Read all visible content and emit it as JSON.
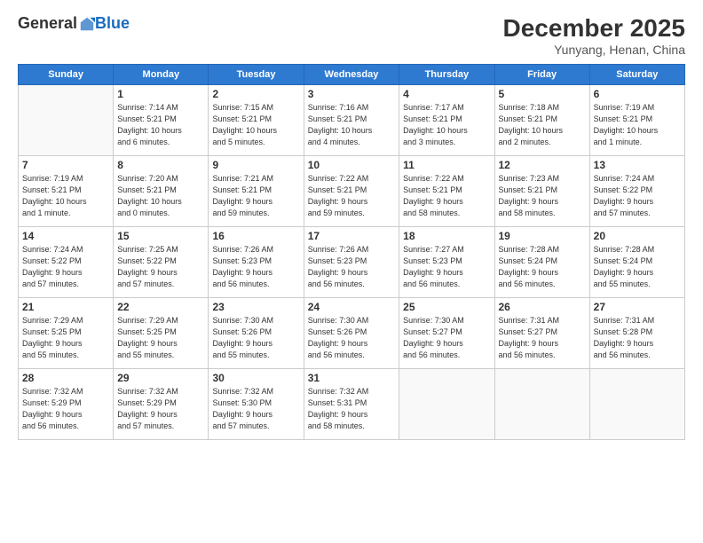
{
  "header": {
    "logo_general": "General",
    "logo_blue": "Blue",
    "month_title": "December 2025",
    "location": "Yunyang, Henan, China"
  },
  "days_of_week": [
    "Sunday",
    "Monday",
    "Tuesday",
    "Wednesday",
    "Thursday",
    "Friday",
    "Saturday"
  ],
  "weeks": [
    [
      {
        "day": "",
        "info": ""
      },
      {
        "day": "1",
        "info": "Sunrise: 7:14 AM\nSunset: 5:21 PM\nDaylight: 10 hours\nand 6 minutes."
      },
      {
        "day": "2",
        "info": "Sunrise: 7:15 AM\nSunset: 5:21 PM\nDaylight: 10 hours\nand 5 minutes."
      },
      {
        "day": "3",
        "info": "Sunrise: 7:16 AM\nSunset: 5:21 PM\nDaylight: 10 hours\nand 4 minutes."
      },
      {
        "day": "4",
        "info": "Sunrise: 7:17 AM\nSunset: 5:21 PM\nDaylight: 10 hours\nand 3 minutes."
      },
      {
        "day": "5",
        "info": "Sunrise: 7:18 AM\nSunset: 5:21 PM\nDaylight: 10 hours\nand 2 minutes."
      },
      {
        "day": "6",
        "info": "Sunrise: 7:19 AM\nSunset: 5:21 PM\nDaylight: 10 hours\nand 1 minute."
      }
    ],
    [
      {
        "day": "7",
        "info": "Sunrise: 7:19 AM\nSunset: 5:21 PM\nDaylight: 10 hours\nand 1 minute."
      },
      {
        "day": "8",
        "info": "Sunrise: 7:20 AM\nSunset: 5:21 PM\nDaylight: 10 hours\nand 0 minutes."
      },
      {
        "day": "9",
        "info": "Sunrise: 7:21 AM\nSunset: 5:21 PM\nDaylight: 9 hours\nand 59 minutes."
      },
      {
        "day": "10",
        "info": "Sunrise: 7:22 AM\nSunset: 5:21 PM\nDaylight: 9 hours\nand 59 minutes."
      },
      {
        "day": "11",
        "info": "Sunrise: 7:22 AM\nSunset: 5:21 PM\nDaylight: 9 hours\nand 58 minutes."
      },
      {
        "day": "12",
        "info": "Sunrise: 7:23 AM\nSunset: 5:21 PM\nDaylight: 9 hours\nand 58 minutes."
      },
      {
        "day": "13",
        "info": "Sunrise: 7:24 AM\nSunset: 5:22 PM\nDaylight: 9 hours\nand 57 minutes."
      }
    ],
    [
      {
        "day": "14",
        "info": "Sunrise: 7:24 AM\nSunset: 5:22 PM\nDaylight: 9 hours\nand 57 minutes."
      },
      {
        "day": "15",
        "info": "Sunrise: 7:25 AM\nSunset: 5:22 PM\nDaylight: 9 hours\nand 57 minutes."
      },
      {
        "day": "16",
        "info": "Sunrise: 7:26 AM\nSunset: 5:23 PM\nDaylight: 9 hours\nand 56 minutes."
      },
      {
        "day": "17",
        "info": "Sunrise: 7:26 AM\nSunset: 5:23 PM\nDaylight: 9 hours\nand 56 minutes."
      },
      {
        "day": "18",
        "info": "Sunrise: 7:27 AM\nSunset: 5:23 PM\nDaylight: 9 hours\nand 56 minutes."
      },
      {
        "day": "19",
        "info": "Sunrise: 7:28 AM\nSunset: 5:24 PM\nDaylight: 9 hours\nand 56 minutes."
      },
      {
        "day": "20",
        "info": "Sunrise: 7:28 AM\nSunset: 5:24 PM\nDaylight: 9 hours\nand 55 minutes."
      }
    ],
    [
      {
        "day": "21",
        "info": "Sunrise: 7:29 AM\nSunset: 5:25 PM\nDaylight: 9 hours\nand 55 minutes."
      },
      {
        "day": "22",
        "info": "Sunrise: 7:29 AM\nSunset: 5:25 PM\nDaylight: 9 hours\nand 55 minutes."
      },
      {
        "day": "23",
        "info": "Sunrise: 7:30 AM\nSunset: 5:26 PM\nDaylight: 9 hours\nand 55 minutes."
      },
      {
        "day": "24",
        "info": "Sunrise: 7:30 AM\nSunset: 5:26 PM\nDaylight: 9 hours\nand 56 minutes."
      },
      {
        "day": "25",
        "info": "Sunrise: 7:30 AM\nSunset: 5:27 PM\nDaylight: 9 hours\nand 56 minutes."
      },
      {
        "day": "26",
        "info": "Sunrise: 7:31 AM\nSunset: 5:27 PM\nDaylight: 9 hours\nand 56 minutes."
      },
      {
        "day": "27",
        "info": "Sunrise: 7:31 AM\nSunset: 5:28 PM\nDaylight: 9 hours\nand 56 minutes."
      }
    ],
    [
      {
        "day": "28",
        "info": "Sunrise: 7:32 AM\nSunset: 5:29 PM\nDaylight: 9 hours\nand 56 minutes."
      },
      {
        "day": "29",
        "info": "Sunrise: 7:32 AM\nSunset: 5:29 PM\nDaylight: 9 hours\nand 57 minutes."
      },
      {
        "day": "30",
        "info": "Sunrise: 7:32 AM\nSunset: 5:30 PM\nDaylight: 9 hours\nand 57 minutes."
      },
      {
        "day": "31",
        "info": "Sunrise: 7:32 AM\nSunset: 5:31 PM\nDaylight: 9 hours\nand 58 minutes."
      },
      {
        "day": "",
        "info": ""
      },
      {
        "day": "",
        "info": ""
      },
      {
        "day": "",
        "info": ""
      }
    ]
  ]
}
